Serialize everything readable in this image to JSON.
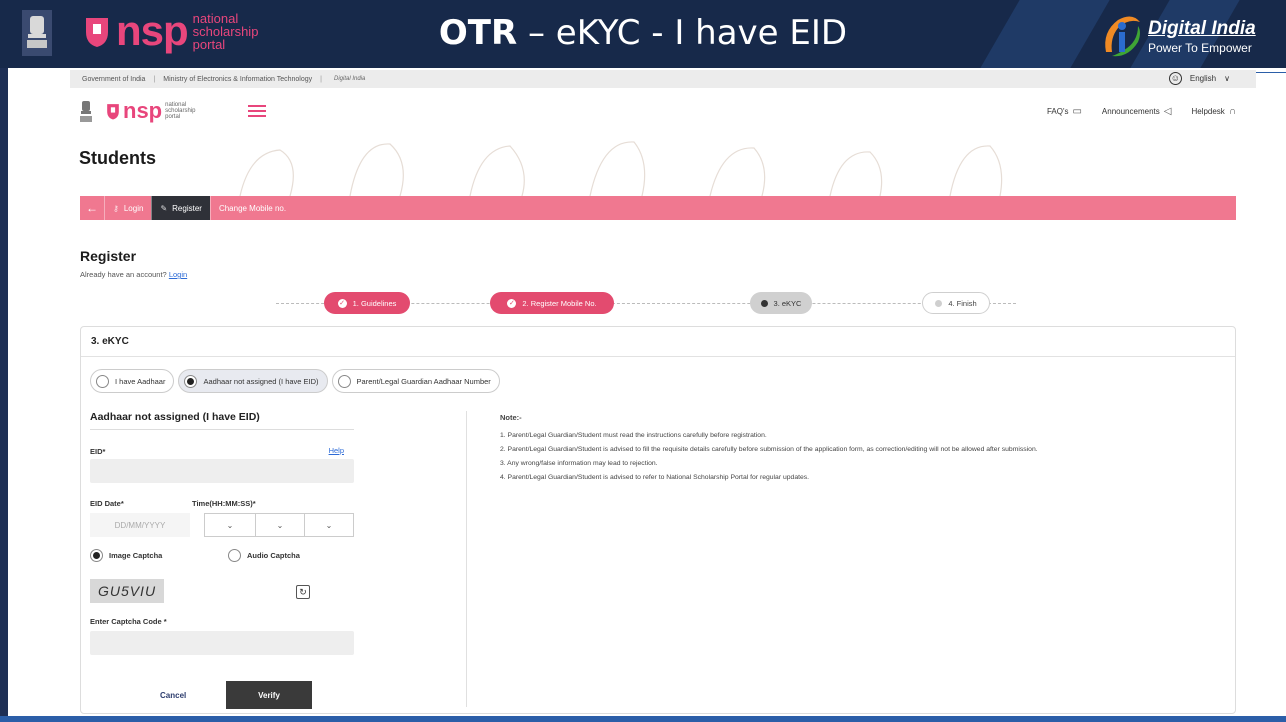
{
  "slide": {
    "title_bold": "OTR",
    "title_rest": " – eKYC -  I have EID",
    "nsp_logo": {
      "name": "nsp",
      "sub1": "national",
      "sub2": "scholarship",
      "sub3": "portal"
    },
    "digital_india": {
      "name": "Digital India",
      "tagline": "Power To Empower"
    },
    "banner_color": "#17294a"
  },
  "gov_bar": {
    "gov": "Government of India",
    "ministry": "Ministry of Electronics & Information Technology",
    "di_mini": "Digital India",
    "language": "English"
  },
  "portal": {
    "logo_name": "nsp",
    "logo_sub1": "national",
    "logo_sub2": "scholarship",
    "logo_sub3": "portal",
    "links": {
      "faq": "FAQ's",
      "announcements": "Announcements",
      "helpdesk": "Helpdesk"
    },
    "section_title": "Students"
  },
  "navbar": {
    "login": "Login",
    "register": "Register",
    "change_mobile": "Change Mobile no.",
    "accent": "#f07890"
  },
  "register": {
    "title": "Register",
    "sub_text": "Already have an account?",
    "login_link": "Login",
    "steps": [
      {
        "label": "1. Guidelines",
        "state": "done"
      },
      {
        "label": "2. Register Mobile No.",
        "state": "done"
      },
      {
        "label": "3. eKYC",
        "state": "current"
      },
      {
        "label": "4. Finish",
        "state": "pending"
      }
    ]
  },
  "card": {
    "header": "3. eKYC",
    "options": [
      {
        "label": "I have Aadhaar",
        "selected": false
      },
      {
        "label": "Aadhaar not assigned (I have EID)",
        "selected": true
      },
      {
        "label": "Parent/Legal Guardian Aadhaar Number",
        "selected": false
      }
    ],
    "form": {
      "title": "Aadhaar not assigned (I have EID)",
      "eid_label": "EID*",
      "help": "Help",
      "eid_value": "",
      "eid_date_label": "EID Date*",
      "eid_date_placeholder": "DD/MM/YYYY",
      "time_label": "Time(HH:MM:SS)*",
      "image_captcha": "Image Captcha",
      "audio_captcha": "Audio Captcha",
      "captcha_text": "GU5VIU",
      "captcha_code_label": "Enter Captcha Code *",
      "captcha_code_value": "",
      "cancel": "Cancel",
      "verify": "Verify"
    },
    "notes": {
      "title": "Note:-",
      "lines": [
        "1. Parent/Legal Guardian/Student must read the instructions carefully before registration.",
        "2. Parent/Legal Guardian/Student is advised to fill the requisite details carefully before submission of the application form, as correction/editing will not be allowed after submission.",
        "3. Any wrong/false information may lead to rejection.",
        "4. Parent/Legal Guardian/Student is advised to refer to National Scholarship Portal for regular updates."
      ]
    }
  }
}
